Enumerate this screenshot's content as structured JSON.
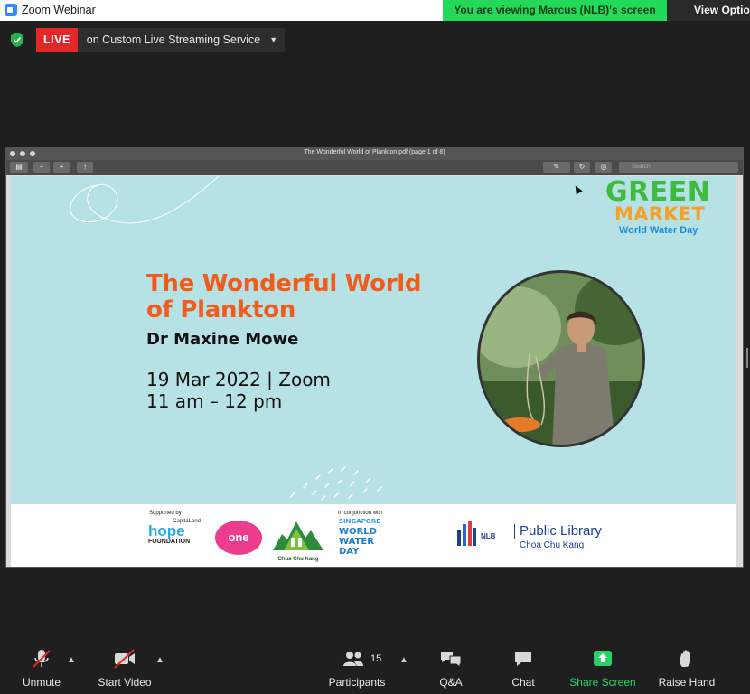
{
  "window": {
    "title": "Zoom Webinar"
  },
  "banner": {
    "viewing_text": "You are viewing Marcus (NLB)'s screen",
    "view_options": "View Options"
  },
  "live": {
    "badge": "LIVE",
    "service": "on Custom Live Streaming Service"
  },
  "pdf": {
    "doc_title": "The Wonderful World of Plankton.pdf (page 1 of 8)",
    "search_placeholder": "Search"
  },
  "slide": {
    "title_line1": "The Wonderful World",
    "title_line2": "of Plankton",
    "speaker": "Dr Maxine Mowe",
    "date": "19 Mar 2022 | Zoom",
    "time": "11 am – 12 pm",
    "brand_green": "GREEN",
    "brand_market": "MARKET",
    "brand_event": "World Water Day"
  },
  "footer": {
    "supported_by": "Supported by",
    "capitaland": "CapitaLand",
    "hope": "hope",
    "foundation": "FOUNDATION",
    "lotone": "one",
    "cck_name": "Chua Chu Kang",
    "in_conjunction": "In conjunction with",
    "sww_line1": "SINGAPORE",
    "sww_line2": "WORLD",
    "sww_line3": "WATER",
    "sww_line4": "DAY",
    "nlb": "NLB",
    "public_library": "Public Library",
    "branch": "Choa Chu Kang"
  },
  "toolbar": {
    "unmute": "Unmute",
    "start_video": "Start Video",
    "participants": "Participants",
    "participant_count": "15",
    "qa": "Q&A",
    "chat": "Chat",
    "share_screen": "Share Screen",
    "raise_hand": "Raise Hand"
  },
  "colors": {
    "live_red": "#e02828",
    "banner_green": "#23d959",
    "slide_bg": "#b6e1e5",
    "title_orange": "#f25c1a",
    "share_green": "#28d26a"
  }
}
